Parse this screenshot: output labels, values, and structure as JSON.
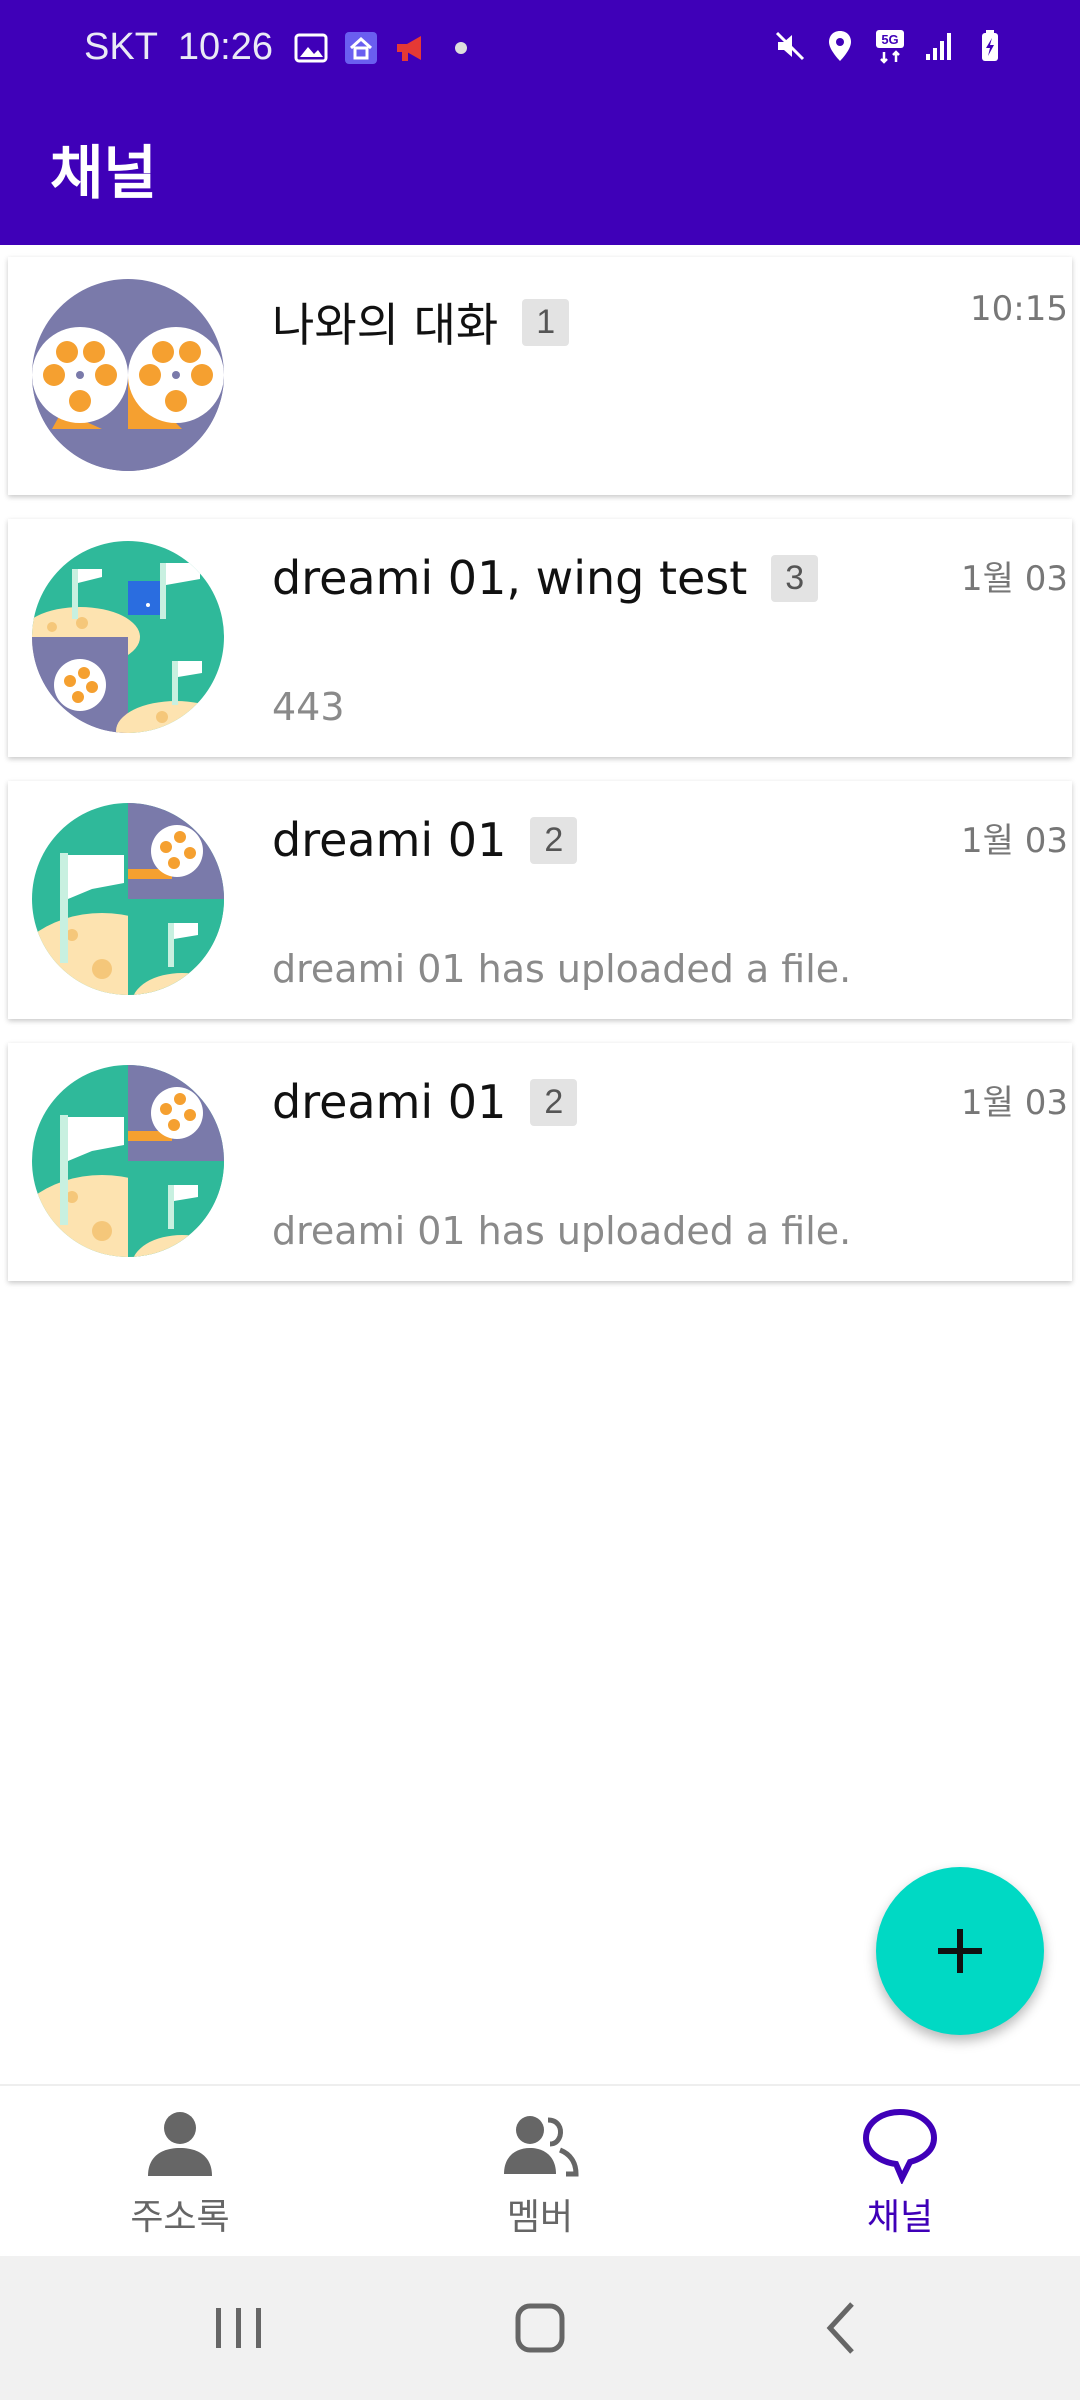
{
  "status_bar": {
    "carrier": "SKT",
    "time": "10:26",
    "network": "5G"
  },
  "app_bar": {
    "title": "채널"
  },
  "channels": [
    {
      "name": "나와의 대화",
      "count": "1",
      "time": "10:15",
      "preview": ""
    },
    {
      "name": "dreami 01, wing test",
      "count": "3",
      "time": "1월 03",
      "preview": "443"
    },
    {
      "name": "dreami 01",
      "count": "2",
      "time": "1월 03",
      "preview": "dreami 01 has uploaded a file."
    },
    {
      "name": "dreami 01",
      "count": "2",
      "time": "1월 03",
      "preview": "dreami 01 has uploaded a file."
    }
  ],
  "fab": {
    "icon": "plus-icon"
  },
  "bottom_nav": {
    "items": [
      {
        "label": "주소록",
        "icon": "person-icon",
        "active": false
      },
      {
        "label": "멤버",
        "icon": "group-icon",
        "active": false
      },
      {
        "label": "채널",
        "icon": "chat-bubble-icon",
        "active": true
      }
    ]
  },
  "colors": {
    "primary": "#3f00b8",
    "accent": "#00d9c4",
    "avatar_purple": "#7a7aaa",
    "avatar_green": "#2fb99a",
    "avatar_orange": "#f5a030",
    "avatar_sand": "#fde3b0"
  }
}
